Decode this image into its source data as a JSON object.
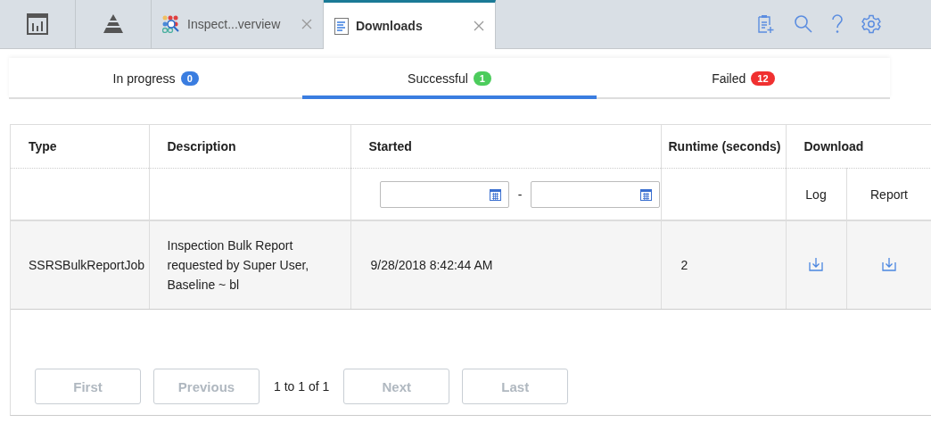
{
  "tabs": [
    {
      "kind": "chart",
      "selected": false
    },
    {
      "kind": "pyramid",
      "selected": false
    },
    {
      "kind": "app",
      "title": "Inspect...verview",
      "closable": true,
      "selected": false
    },
    {
      "kind": "document",
      "title": "Downloads",
      "closable": true,
      "selected": true
    }
  ],
  "status_tabs": [
    {
      "label": "In progress",
      "count": "0",
      "color": "#3a7de0",
      "selected": false
    },
    {
      "label": "Successful",
      "count": "1",
      "color": "#4ccc5c",
      "selected": true
    },
    {
      "label": "Failed",
      "count": "12",
      "color": "#f03030",
      "selected": false
    }
  ],
  "table": {
    "columns": [
      "Type",
      "Description",
      "Started",
      "Runtime (seconds)",
      "Download"
    ],
    "download_subcolumns": [
      "Log",
      "Report"
    ],
    "date_separator": "-",
    "rows": [
      {
        "type": "SSRSBulkReportJob",
        "description": "Inspection Bulk Report requested by Super User, Baseline ~ bl",
        "started": "9/28/2018 8:42:44 AM",
        "runtime": "2"
      }
    ]
  },
  "pager": {
    "buttons": [
      {
        "label": "First",
        "disabled": true
      },
      {
        "label": "Previous",
        "disabled": true
      },
      {
        "label": "Next",
        "disabled": true
      },
      {
        "label": "Last",
        "disabled": true
      }
    ],
    "range": "1 to 1 of 1"
  }
}
